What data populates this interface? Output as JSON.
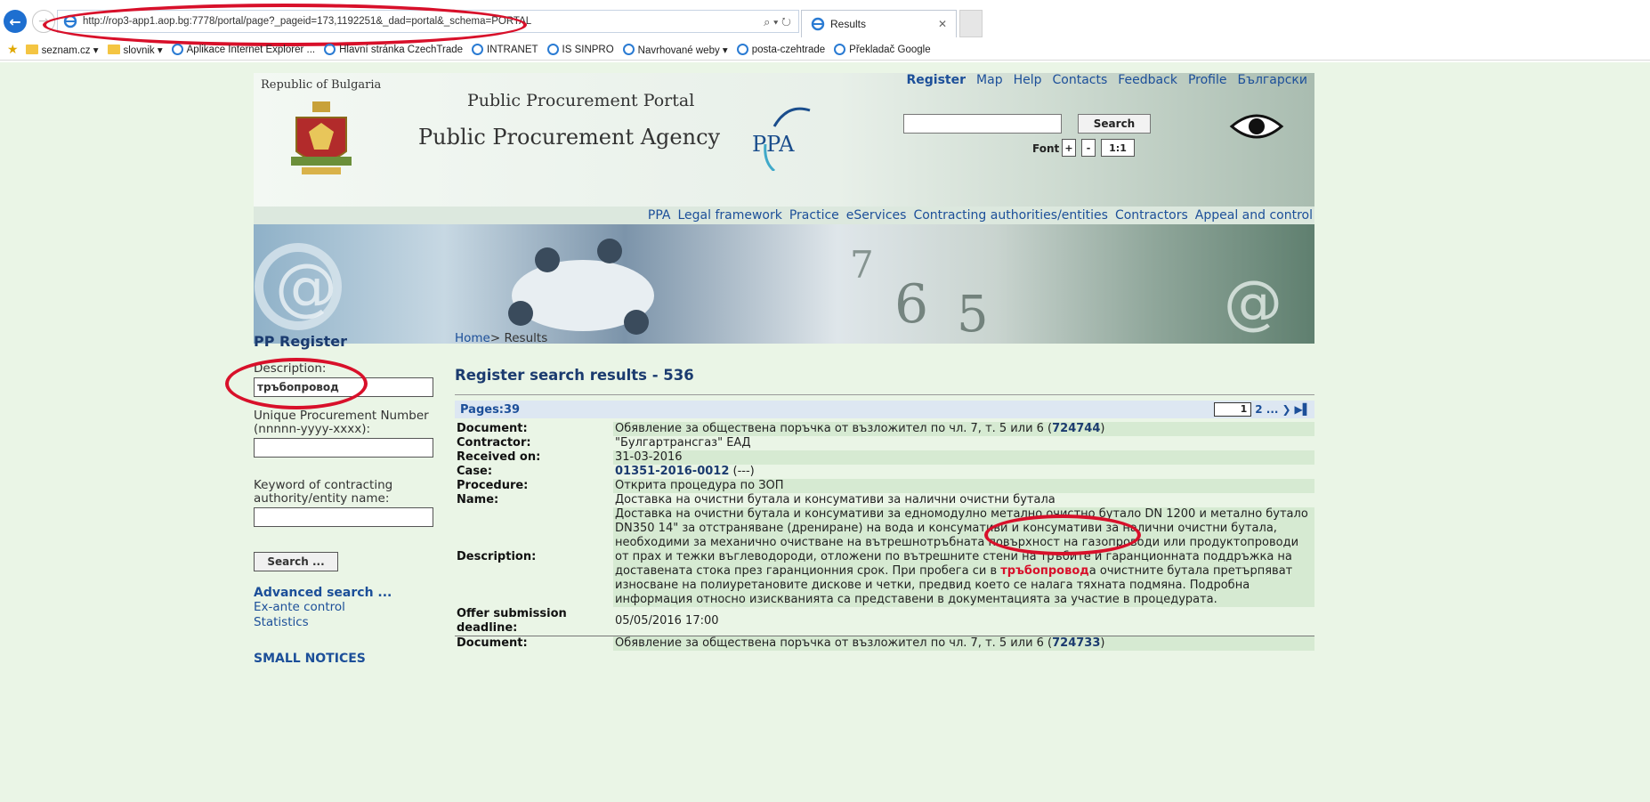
{
  "browser": {
    "url": "http://rop3-app1.aop.bg:7778/portal/page?_pageid=173,1192251&_dad=portal&_schema=PORTAL",
    "tab_title": "Results",
    "addr_tools": "⌕ ▾ ↻",
    "favorites": [
      {
        "label": "seznam.cz ▾",
        "icon": "folder"
      },
      {
        "label": "slovnik ▾",
        "icon": "folder"
      },
      {
        "label": "Aplikace Internet Explorer ...",
        "icon": "ie"
      },
      {
        "label": "Hlavní stránka CzechTrade",
        "icon": "ie"
      },
      {
        "label": "INTRANET",
        "icon": "ie"
      },
      {
        "label": "IS SINPRO",
        "icon": "ie"
      },
      {
        "label": "Navrhované weby ▾",
        "icon": "ie"
      },
      {
        "label": "posta-czehtrade",
        "icon": "ie"
      },
      {
        "label": "Překladač Google",
        "icon": "ie"
      }
    ]
  },
  "header": {
    "republic": "Republic of Bulgaria",
    "portal_title": "Public Procurement Portal",
    "agency_title": "Public Procurement Agency",
    "logo_text": "PPA",
    "top_links": [
      "Register",
      "Map",
      "Help",
      "Contacts",
      "Feedback",
      "Profile",
      "Български"
    ],
    "search_button": "Search",
    "font_label": "Font",
    "font_plus": "+",
    "font_minus": "-",
    "font_reset": "1:1",
    "nav": [
      "PPA",
      "Legal framework",
      "Practice",
      "eServices",
      "Contracting authorities/entities",
      "Contractors",
      "Appeal and control"
    ]
  },
  "left": {
    "title": "PP Register",
    "description_label": "Description:",
    "description_value": "тръбопровод",
    "upn_label": "Unique Procurement Number (nnnnn-yyyy-xxxx):",
    "keyword_label": "Keyword of contracting authority/entity name:",
    "search_button": "Search ...",
    "advanced": "Advanced search ...",
    "exante": "Ex-ante control",
    "statistics": "Statistics",
    "small_notices": "SMALL NOTICES"
  },
  "content": {
    "breadcrumb_home": "Home",
    "breadcrumb_current": "> Results",
    "results_title": "Register search results - 536",
    "pages_label": "Pages:39",
    "page_current": "1",
    "pager_more": "2 ...",
    "record": {
      "document_label": "Document:",
      "document_text": "Обявление за обществена поръчка от възложител по чл. 7, т. 5 или 6 (",
      "document_id": "724744",
      "document_close": ")",
      "contractor_label": "Contractor:",
      "contractor": "\"Булгартрансгаз\" ЕАД",
      "received_label": "Received on:",
      "received": "31-03-2016",
      "case_label": "Case:",
      "case_id": "01351-2016-0012",
      "case_suffix": " (---)",
      "procedure_label": "Procedure:",
      "procedure": "Открита процедура по ЗОП",
      "name_label": "Name:",
      "name": "Доставка на очистни бутала и консумативи за налични очистни бутала",
      "description_label": "Description:",
      "description_before": "Доставка на очистни бутала и консумативи за едномодулно метално очистно бутало DN 1200 и метално бутало DN350 14\" за отстраняване (дрениране) на вода и консумативи и консумативи за налични очистни бутала, необходими за механично очистване на вътрешнотръбната повърхност на газопроводи или продуктопроводи от прах и тежки въглеводороди, отложени по вътрешните стени на тръбите и гаранционната поддръжка на доставената стока през гаранционния срок. При пробега си в ",
      "description_highlight": "тръбопровод",
      "description_after": "а очистните бутала претърпяват износване на полиуретановите дискове и четки, предвид което се налага тяхната подмяна. Подробна информация относно изискванията са представени в документацията за участие в процедурата.",
      "deadline_label": "Offer submission deadline:",
      "deadline": "05/05/2016 17:00"
    },
    "record2": {
      "document_label": "Document:",
      "document_text": "Обявление за обществена поръчка от възложител по чл. 7, т. 5 или 6 (",
      "document_id": "724733",
      "document_close": ")"
    }
  },
  "colors": {
    "page_bg": "#eaf5e6",
    "link": "#1c4f99",
    "annotation": "#d8102a",
    "row_shade": "#d6ead2"
  }
}
